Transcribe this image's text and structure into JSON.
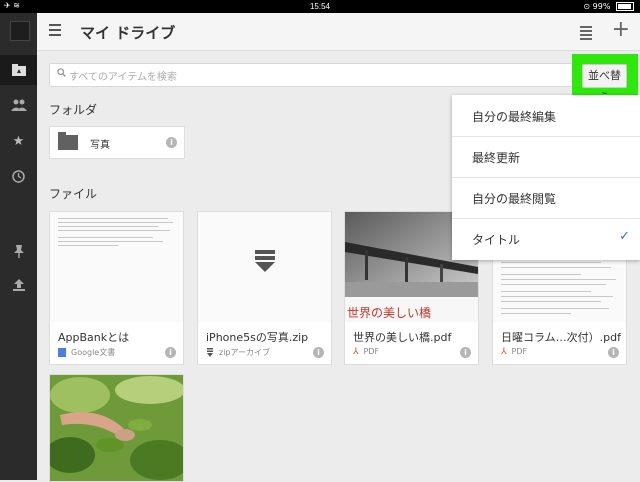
{
  "status": {
    "time": "15:54",
    "battery": "99%"
  },
  "header": {
    "title": "マイ ドライブ"
  },
  "search": {
    "placeholder": "すべてのアイテムを検索"
  },
  "sort_button": {
    "label": "並べ替え"
  },
  "sections": {
    "folders": "フォルダ",
    "files": "ファイル"
  },
  "folders": [
    {
      "name": "写真"
    }
  ],
  "files": [
    {
      "name": "AppBankとは",
      "type": "Google文書"
    },
    {
      "name": "iPhone5sの写真.zip",
      "type": "zipアーカイブ"
    },
    {
      "name": "世界の美しい橋.pdf",
      "type": "PDF"
    },
    {
      "name": "日曜コラム…次付）.pdf",
      "type": "PDF"
    }
  ],
  "thumb_text": {
    "bridge_caption": "世界の美しい橋"
  },
  "sort_menu": {
    "options": [
      {
        "label": "自分の最終編集"
      },
      {
        "label": "最終更新"
      },
      {
        "label": "自分の最終閲覧"
      },
      {
        "label": "タイトル",
        "selected": true
      }
    ]
  },
  "colors": {
    "highlight": "#2de80a",
    "check": "#2f6fd1",
    "docs_blue": "#4a7fe0",
    "pdf_red": "#d9442a"
  },
  "icons": {
    "info": "i",
    "check": "✓",
    "plus": "+",
    "search": "⚲"
  }
}
